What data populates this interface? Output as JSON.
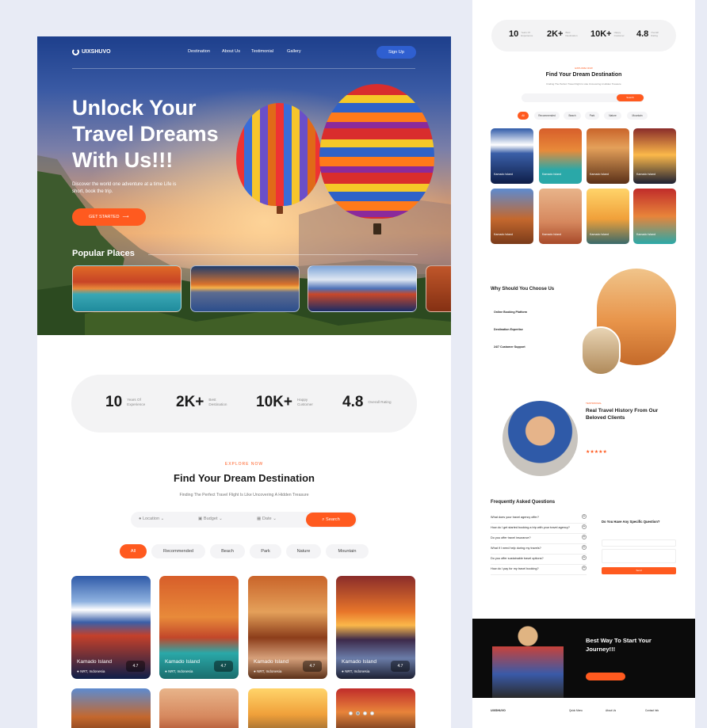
{
  "site": {
    "brand": "UIXSHUVO",
    "nav": [
      "Destination",
      "About Us",
      "Testimonial",
      "Gallery"
    ],
    "signup": "Sign Up"
  },
  "hero": {
    "title": "Unlock Your Travel Dreams With Us!!!",
    "subtitle": "Discover the world one adventure at a time Life is short, book the trip.",
    "cta": "GET STARTED",
    "popular_title": "Popular Places"
  },
  "stats": [
    {
      "value": "10",
      "label": "Years Of Experience"
    },
    {
      "value": "2K+",
      "label": "Best Destination"
    },
    {
      "value": "10K+",
      "label": "Happy Customer"
    },
    {
      "value": "4.8",
      "label": "Overall Rating"
    }
  ],
  "explore": {
    "kicker": "EXPLORE NOW",
    "title": "Find Your Dream Destination",
    "subtitle": "Finding The Perfect Travel Flight Is Like Uncovering A Hidden Treasure",
    "fields": [
      "Location",
      "Budget",
      "Date"
    ],
    "search": "Search",
    "chips": [
      "All",
      "Recommended",
      "Beach",
      "Park",
      "Nature",
      "Mountain"
    ]
  },
  "cards": [
    {
      "name": "Kamado Island",
      "loc": "NRT, Indonesia",
      "rating": "4.7"
    },
    {
      "name": "Kamado Island",
      "loc": "NRT, Indonesia",
      "rating": "4.7"
    },
    {
      "name": "Kamado Island",
      "loc": "NRT, Indonesia",
      "rating": "4.7"
    },
    {
      "name": "Kamado Island",
      "loc": "NRT, Indonesia",
      "rating": "4.7"
    }
  ],
  "right": {
    "why_title": "Why Should You Choose Us",
    "features": [
      "Online Booking Platform",
      "Destination Expertise",
      "24/7 Customer Support"
    ],
    "testimonial_kicker": "TESTIMONIAL",
    "testimonial_title": "Real Travel History From Our Beloved Clients",
    "faq_title": "Frequently Asked Questions",
    "faqs": [
      "What does your travel agency offer?",
      "How do I get started booking a trip with your travel agency?",
      "Do you offer travel insurance?",
      "What if I need help during my travels?",
      "Do you offer sustainable travel options?",
      "How do I pay for my travel booking?"
    ],
    "question_title": "Do You Have Any Specific Question?",
    "send": "Send",
    "cta_title": "Best Way To Start Your Journey!!!",
    "footer_cols": [
      "Quick Menu",
      "About Us",
      "Contact Info"
    ]
  }
}
